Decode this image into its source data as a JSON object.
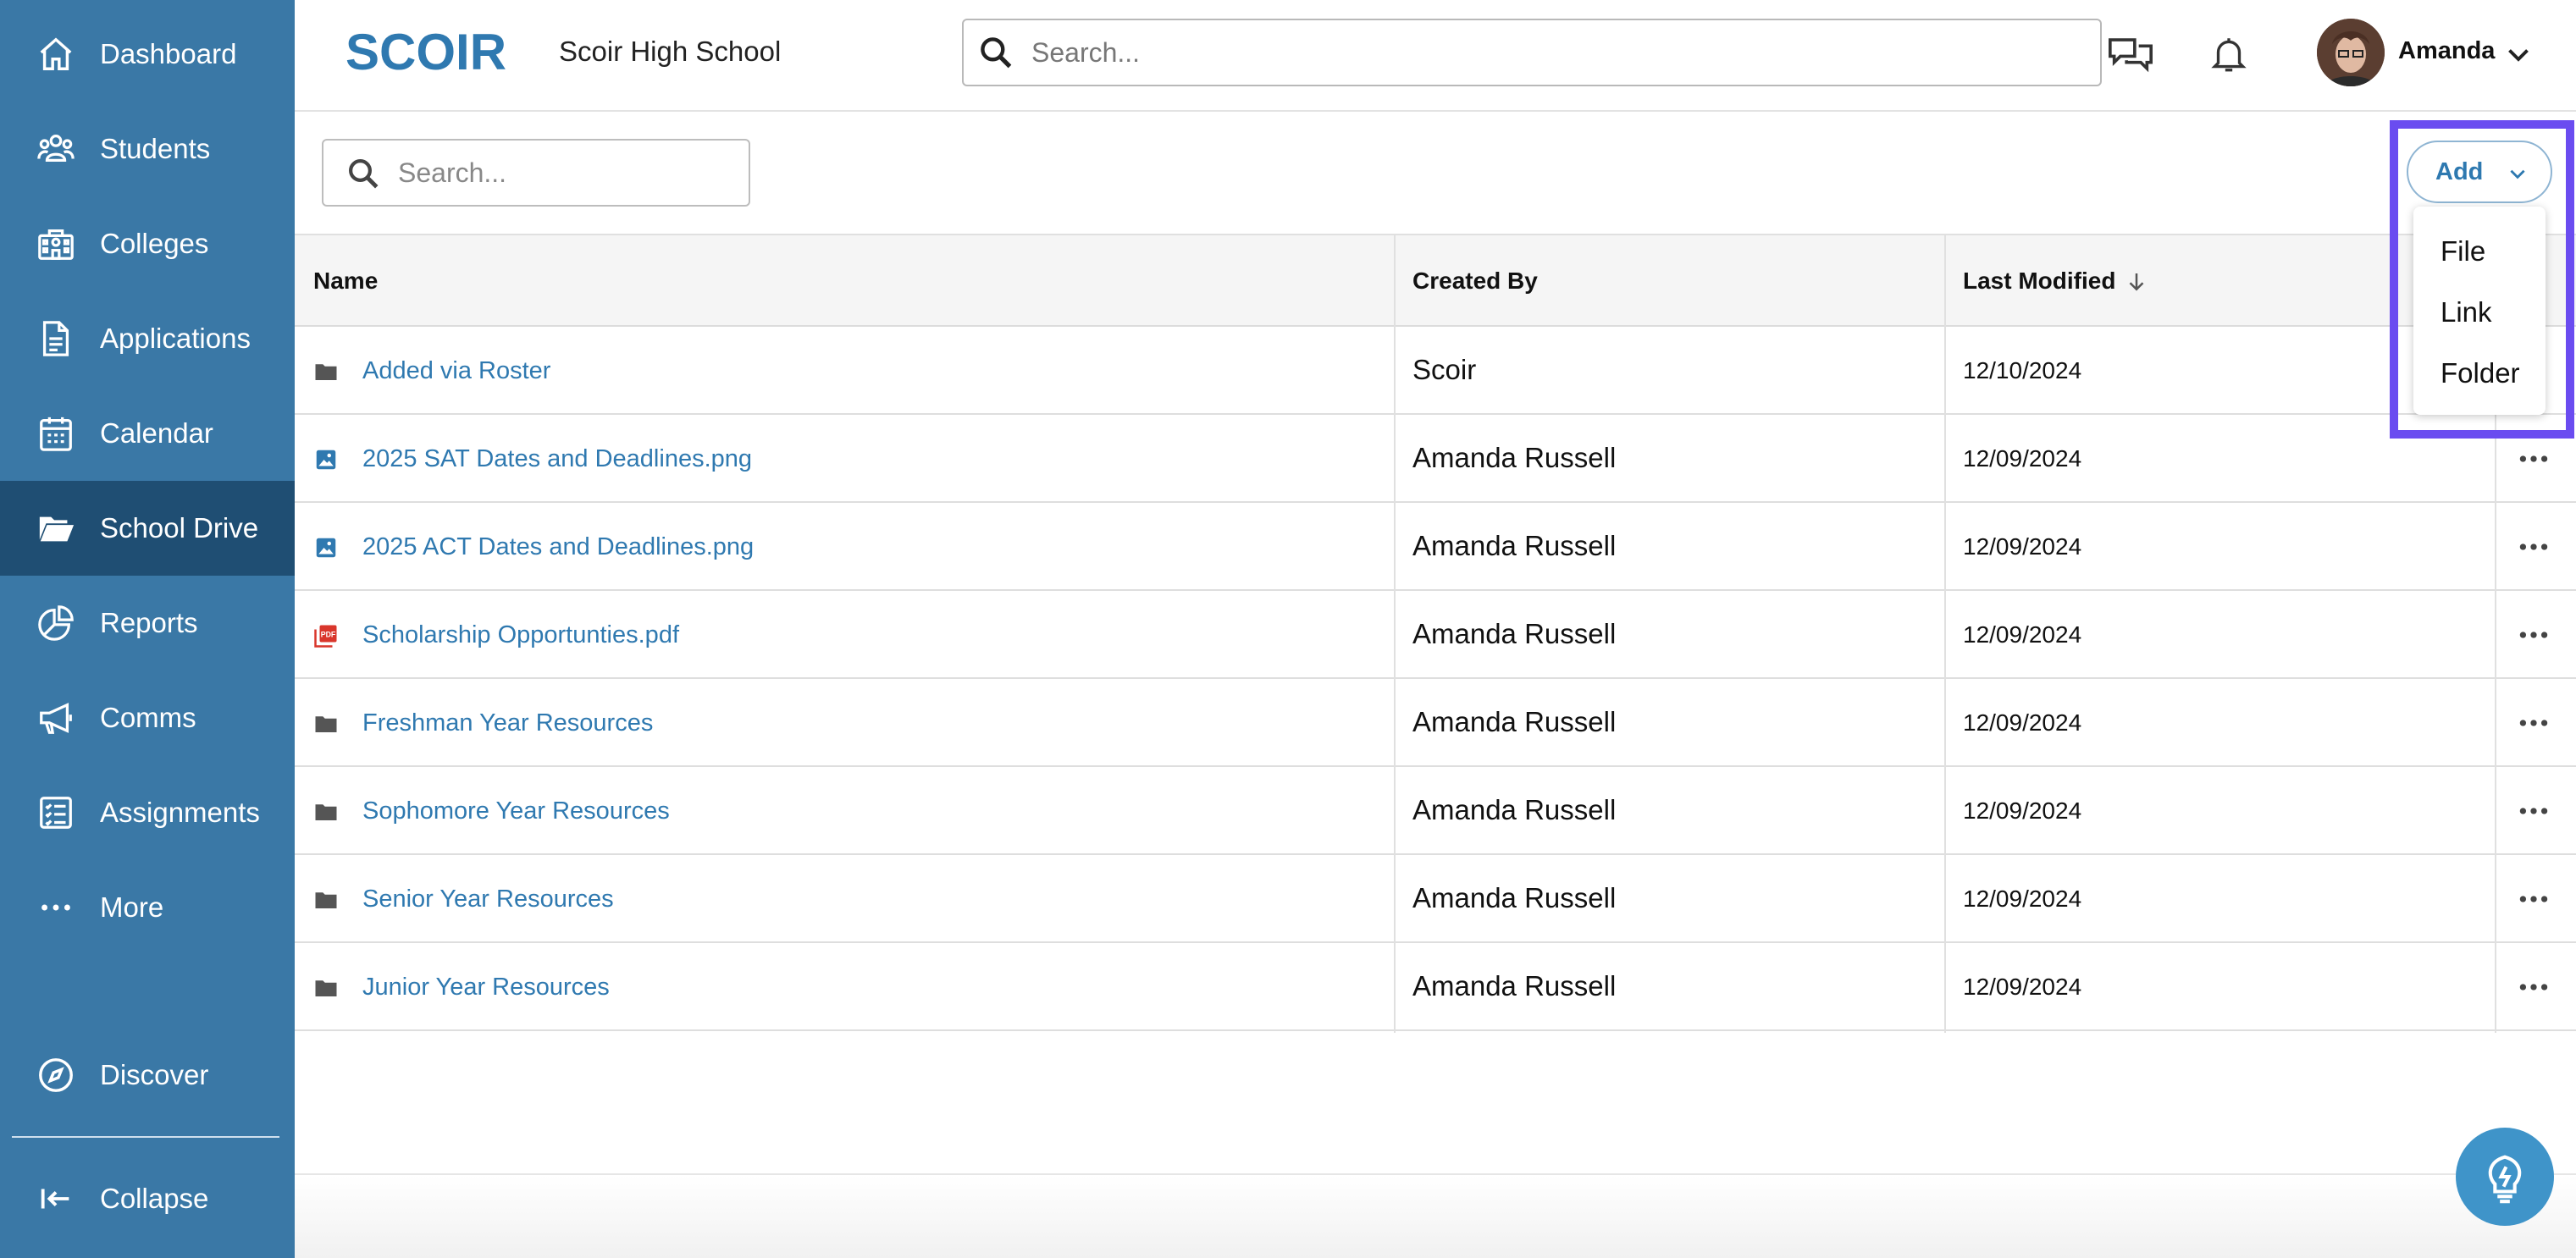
{
  "sidebar": {
    "items": [
      {
        "label": "Dashboard",
        "icon": "home-icon"
      },
      {
        "label": "Students",
        "icon": "students-icon"
      },
      {
        "label": "Colleges",
        "icon": "college-icon"
      },
      {
        "label": "Applications",
        "icon": "document-icon"
      },
      {
        "label": "Calendar",
        "icon": "calendar-icon"
      },
      {
        "label": "School Drive",
        "icon": "folder-open-icon",
        "active": true
      },
      {
        "label": "Reports",
        "icon": "pie-chart-icon"
      },
      {
        "label": "Comms",
        "icon": "megaphone-icon"
      },
      {
        "label": "Assignments",
        "icon": "checklist-icon"
      },
      {
        "label": "More",
        "icon": "ellipsis-icon"
      }
    ],
    "discover_label": "Discover",
    "collapse_label": "Collapse"
  },
  "header": {
    "logo_text": "SCOIR",
    "school_name": "Scoir High School",
    "search_placeholder": "Search...",
    "user_name": "Amanda"
  },
  "toolbar": {
    "search_placeholder": "Search...",
    "add_label": "Add",
    "add_menu": [
      "File",
      "Link",
      "Folder"
    ]
  },
  "table": {
    "columns": [
      "Name",
      "Created By",
      "Last Modified"
    ],
    "rows": [
      {
        "name": "Added via Roster",
        "type": "folder",
        "created_by": "Scoir",
        "modified": "12/10/2024"
      },
      {
        "name": "2025 SAT Dates and Deadlines.png",
        "type": "image",
        "created_by": "Amanda Russell",
        "modified": "12/09/2024"
      },
      {
        "name": "2025 ACT Dates and Deadlines.png",
        "type": "image",
        "created_by": "Amanda Russell",
        "modified": "12/09/2024"
      },
      {
        "name": "Scholarship Opportunties.pdf",
        "type": "pdf",
        "created_by": "Amanda Russell",
        "modified": "12/09/2024"
      },
      {
        "name": "Freshman Year Resources",
        "type": "folder",
        "created_by": "Amanda Russell",
        "modified": "12/09/2024"
      },
      {
        "name": "Sophomore Year Resources",
        "type": "folder",
        "created_by": "Amanda Russell",
        "modified": "12/09/2024"
      },
      {
        "name": "Senior Year Resources",
        "type": "folder",
        "created_by": "Amanda Russell",
        "modified": "12/09/2024"
      },
      {
        "name": "Junior Year Resources",
        "type": "folder",
        "created_by": "Amanda Russell",
        "modified": "12/09/2024"
      }
    ]
  },
  "colors": {
    "sidebar": "#3a78a6",
    "sidebar_active": "#1f4e73",
    "link": "#2f79b0",
    "highlight": "#6a4cf0",
    "fab": "#3f94c9"
  }
}
